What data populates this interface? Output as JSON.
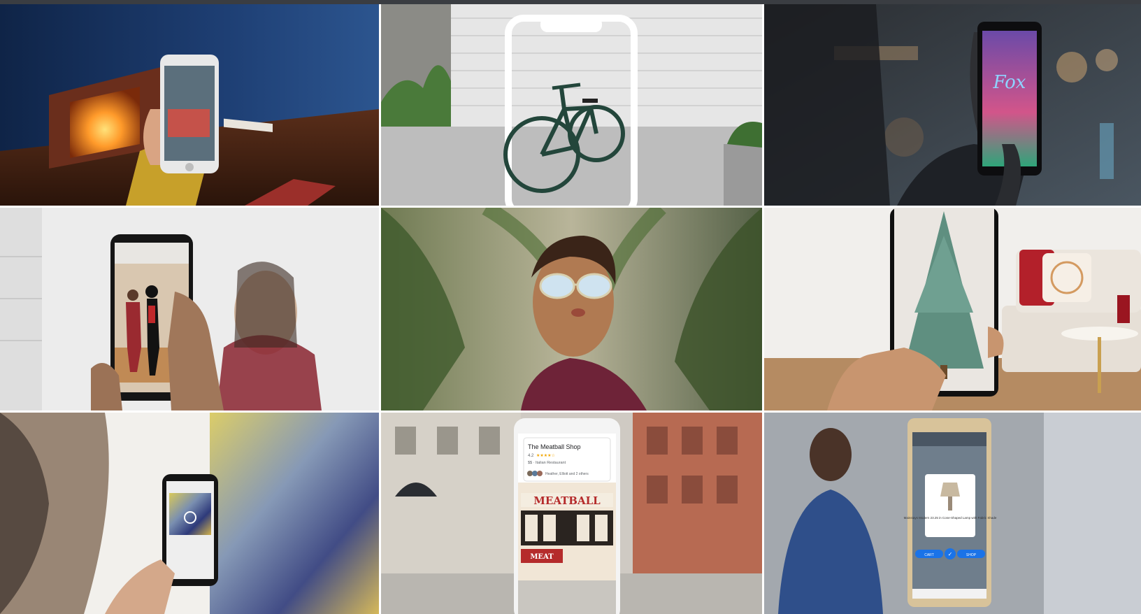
{
  "image": {
    "layout": "3x3 photo collage",
    "description_free": true
  },
  "tiles": {
    "meatball_card": {
      "title": "The Meatball Shop",
      "rating": "4.2",
      "category": "$$ · Italian Restaurant",
      "friends": "Heather, Elliott and 2 others",
      "sign": "MEATBALL",
      "awning": "MEAT"
    },
    "fox_theatre": {
      "marquee": "Fox"
    },
    "lamp_card": {
      "product": "Mainstays Modern 23.25 in Cone-Shaped Lamp with Fabric Shade",
      "left_action": "CART",
      "right_action": "SHOP"
    }
  },
  "colors": {
    "topbar": "#3a3d42",
    "room_blue": "#1e3f74",
    "garage_white": "#e6e6e6",
    "bike_green": "#23463b",
    "tree_green": "#5f8f80",
    "sofa_red": "#b3202a",
    "meatball_red": "#b52b2b"
  }
}
